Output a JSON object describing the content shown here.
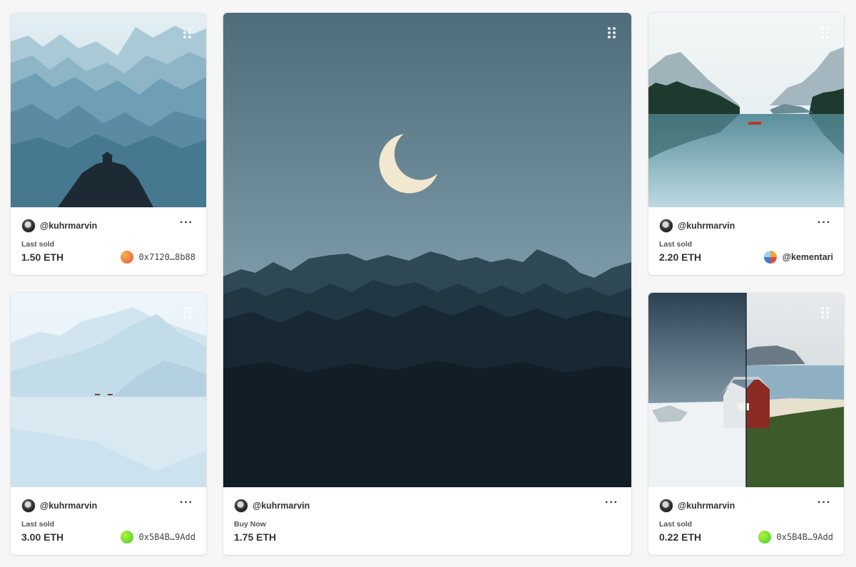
{
  "cards": [
    {
      "artwork": "blue-mountain-ranges-with-hut",
      "owner": "@kuhrmarvin",
      "status_label": "Last sold",
      "price": "1.50 ETH",
      "holder": "0x7120…8b88",
      "holder_avatar_colors": [
        "#f6b24a",
        "#e8563f"
      ]
    },
    {
      "artwork": "crescent-moon-over-mountains",
      "owner": "@kuhrmarvin",
      "status_label": "Buy Now",
      "price": "1.75 ETH"
    },
    {
      "artwork": "lake-reflection-with-canoe",
      "owner": "@kuhrmarvin",
      "status_label": "Last sold",
      "price": "2.20 ETH",
      "holder": "@kementari",
      "holder_avatar_colors": [
        "#f0a33a",
        "#3f7ad6"
      ]
    },
    {
      "artwork": "misty-lake-with-boats",
      "owner": "@kuhrmarvin",
      "status_label": "Last sold",
      "price": "3.00 ETH",
      "holder": "0x5B4B…9Add",
      "holder_avatar_colors": [
        "#b6f23a",
        "#3bd12f"
      ]
    },
    {
      "artwork": "split-cabin-winter-summer",
      "owner": "@kuhrmarvin",
      "status_label": "Last sold",
      "price": "0.22 ETH",
      "holder": "0x5B4B…9Add",
      "holder_avatar_colors": [
        "#b6f23a",
        "#3bd12f"
      ]
    }
  ]
}
